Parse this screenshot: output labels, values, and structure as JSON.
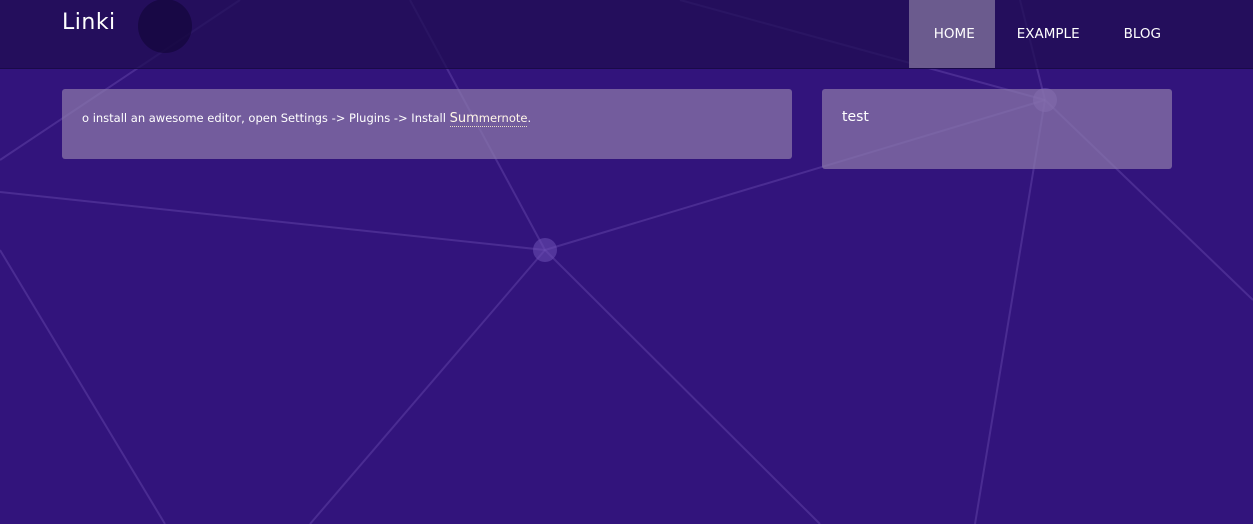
{
  "header": {
    "brand": "Linki",
    "nav": [
      {
        "label": "HOME",
        "active": true
      },
      {
        "label": "EXAMPLE",
        "active": false
      },
      {
        "label": "BLOG",
        "active": false
      }
    ]
  },
  "main_notice": {
    "text_before": "o install an awesome editor, open Settings -> Plugins -> Install ",
    "link_part1": "Sum",
    "link_part2": "mernote",
    "text_after": "."
  },
  "sidebar": {
    "text": "test"
  },
  "colors": {
    "background": "#32147c",
    "header": "#22105a",
    "panel": "#7a6898",
    "active_nav": "#786898"
  }
}
